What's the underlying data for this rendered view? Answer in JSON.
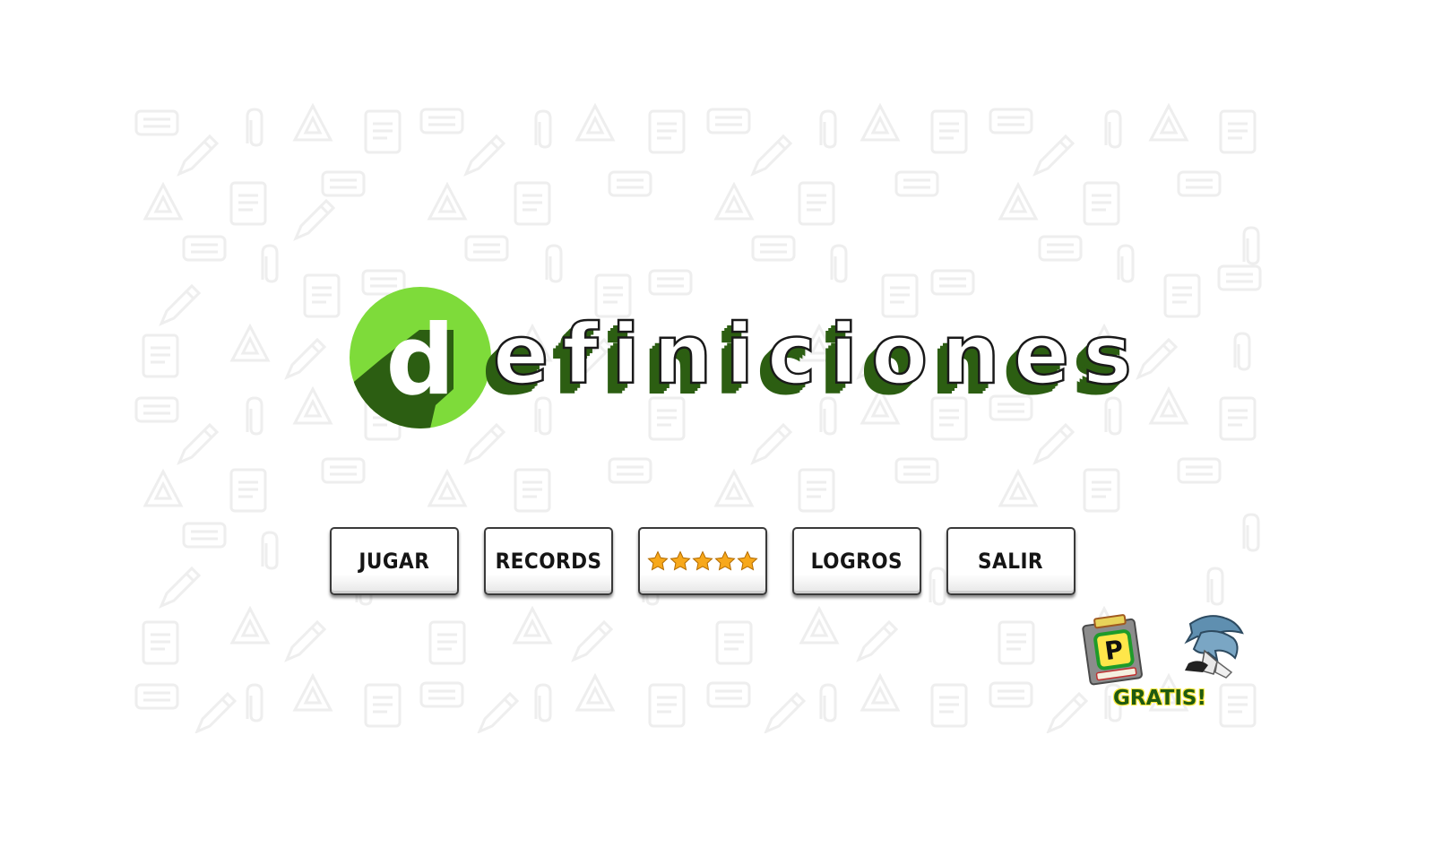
{
  "logo": {
    "letter": "d",
    "rest": "efiniciones",
    "colors": {
      "circle": "#7edb3a",
      "shadow": "#2c5e12"
    }
  },
  "menu": {
    "play_label": "JUGAR",
    "records_label": "RECORDS",
    "rate_stars": 5,
    "achievements_label": "LOGROS",
    "exit_label": "SALIR"
  },
  "promo": {
    "app_icon_letter": "P",
    "label": "GRATIS!"
  },
  "background_icons": [
    "keyboard-icon",
    "pencil-icon",
    "paperclip-icon",
    "document-icon",
    "triangle-ruler-icon"
  ]
}
